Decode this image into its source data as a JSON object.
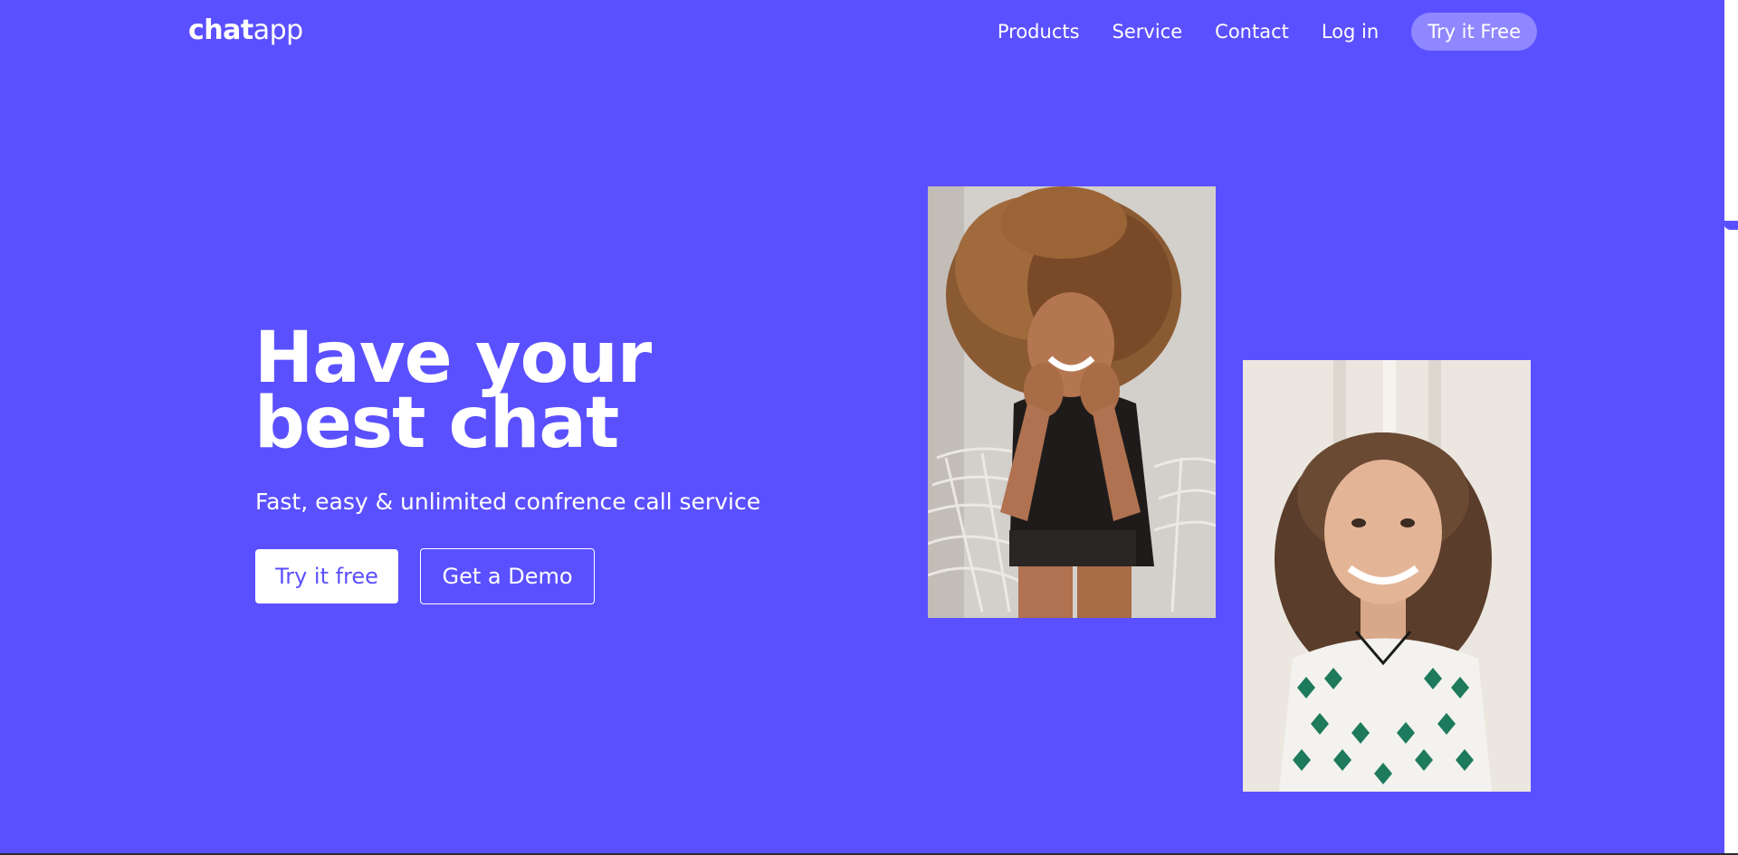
{
  "nav": {
    "logo_bold": "chat",
    "logo_light": "app",
    "links": [
      "Products",
      "Service",
      "Contact",
      "Log in"
    ],
    "cta": "Try it Free"
  },
  "hero": {
    "title_line1": "Have your",
    "title_line2": "best chat",
    "subtitle": "Fast, easy & unlimited confrence call service",
    "primary_button": "Try it free",
    "secondary_button": "Get a Demo"
  },
  "colors": {
    "background": "#5b50ff",
    "nav_cta_bg": "#8f87ff",
    "text": "#ffffff"
  }
}
